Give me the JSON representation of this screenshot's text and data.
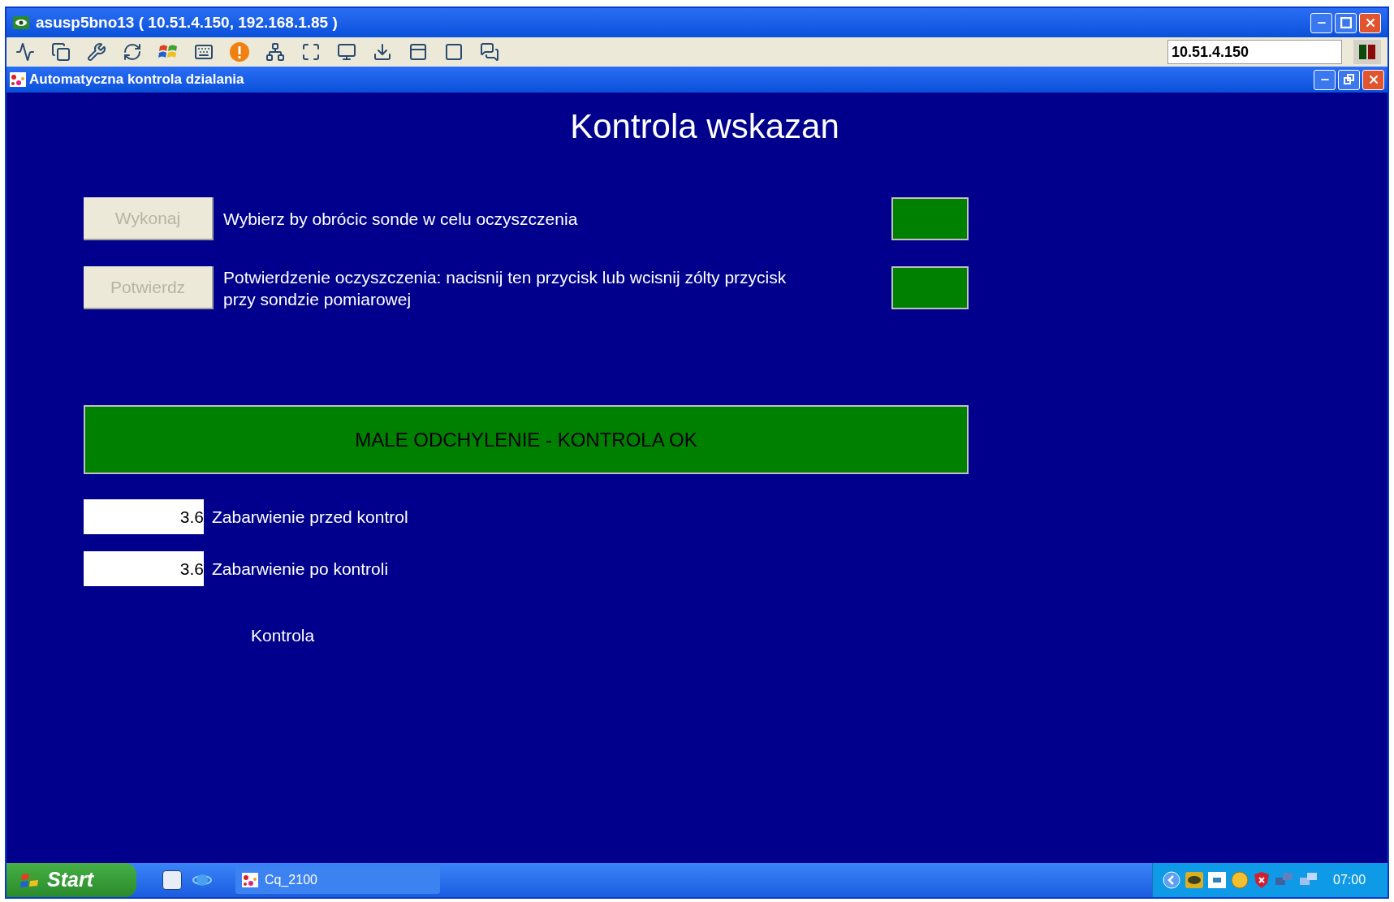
{
  "window": {
    "title": "asusp5bno13 ( 10.51.4.150, 192.168.1.85 )"
  },
  "toolbar": {
    "address": "10.51.4.150"
  },
  "app_window": {
    "title": "Automatyczna kontrola dzialania"
  },
  "heading": "Kontrola wskazan",
  "actions": [
    {
      "button": "Wykonaj",
      "disabled": true,
      "description": "Wybierz by obrócic sonde w celu oczyszczenia",
      "color": "#008000"
    },
    {
      "button": "Potwierdz",
      "disabled": true,
      "description": "Potwierdzenie oczyszczenia: nacisnij ten przycisk lub wcisnij zólty przycisk przy sondzie pomiarowej",
      "color": "#008000"
    }
  ],
  "status_banner": {
    "text": "MALE ODCHYLENIE - KONTROLA OK",
    "color": "#008000"
  },
  "readings": [
    {
      "value": "3.6",
      "label": "Zabarwienie przed kontrol"
    },
    {
      "value": "3.6",
      "label": "Zabarwienie po kontroli"
    }
  ],
  "footer_label": "Kontrola",
  "taskbar": {
    "start": "Start",
    "tasks": [
      {
        "label": "Cq_2100",
        "selected": false
      }
    ],
    "clock": "07:00"
  }
}
